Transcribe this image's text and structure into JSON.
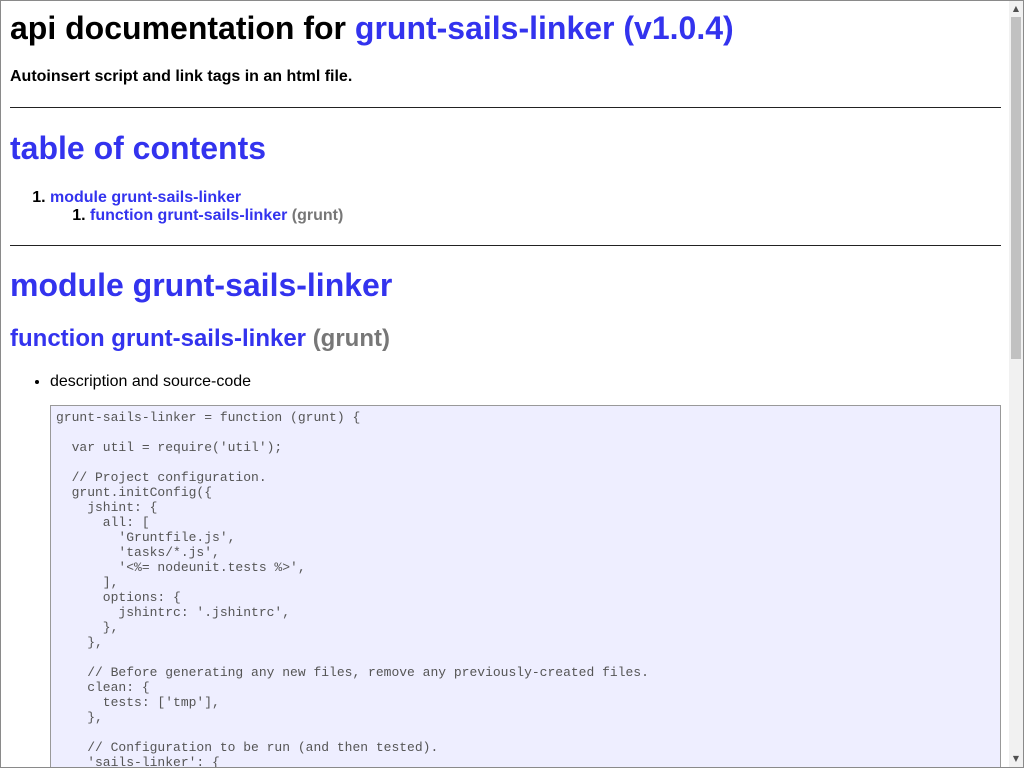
{
  "header": {
    "title_prefix": "api documentation for",
    "title_link": "grunt-sails-linker (v1.0.4)",
    "subtitle": "Autoinsert script and link tags in an html file."
  },
  "toc": {
    "heading": "table of contents",
    "module_link": "module grunt-sails-linker",
    "function_link": "function grunt-sails-linker",
    "function_args": "(grunt)"
  },
  "module_section": {
    "heading": "module grunt-sails-linker",
    "function_heading": "function grunt-sails-linker",
    "function_args": "(grunt)",
    "bullet": "description and source-code",
    "source_code": "grunt-sails-linker = function (grunt) {\n\n  var util = require('util');\n\n  // Project configuration.\n  grunt.initConfig({\n    jshint: {\n      all: [\n        'Gruntfile.js',\n        'tasks/*.js',\n        '<%= nodeunit.tests %>',\n      ],\n      options: {\n        jshintrc: '.jshintrc',\n      },\n    },\n\n    // Before generating any new files, remove any previously-created files.\n    clean: {\n      tests: ['tmp'],\n    },\n\n    // Configuration to be run (and then tested).\n    'sails-linker': {"
  },
  "scrollbar": {
    "up_icon": "arrow-up",
    "down_icon": "arrow-down"
  }
}
